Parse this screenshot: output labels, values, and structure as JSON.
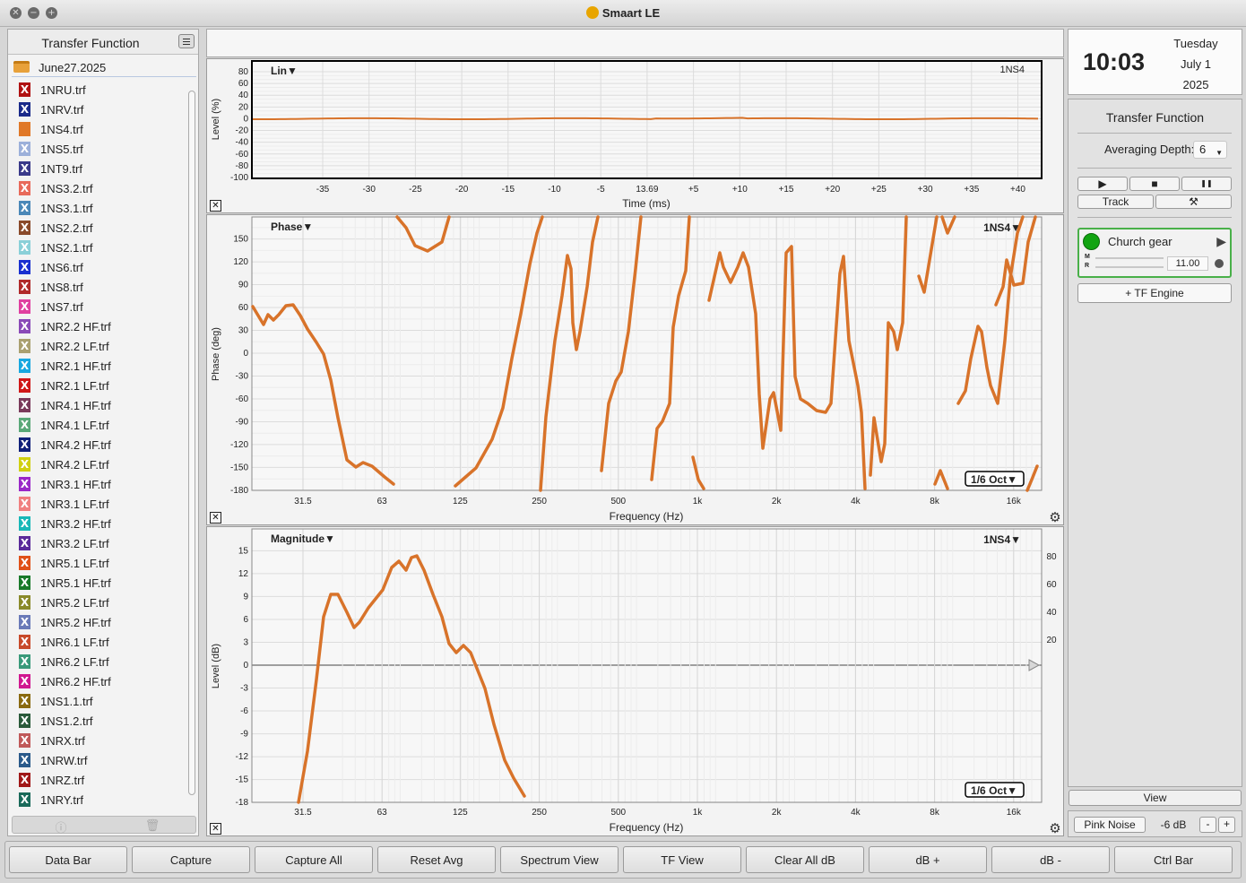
{
  "window": {
    "title": "Smaart LE"
  },
  "left_panel": {
    "title": "Transfer Function",
    "folder": "June27.2025",
    "files": [
      {
        "name": "1NRU.trf",
        "color": "#b01212",
        "glyph": "X"
      },
      {
        "name": "1NRV.trf",
        "color": "#1a2a8a",
        "glyph": "X"
      },
      {
        "name": "1NS4.trf",
        "color": "#e07828",
        "glyph": ""
      },
      {
        "name": "1NS5.trf",
        "color": "#9cb0da",
        "glyph": "X"
      },
      {
        "name": "1NT9.trf",
        "color": "#3a3a8a",
        "glyph": "X"
      },
      {
        "name": "1NS3.2.trf",
        "color": "#e86a5a",
        "glyph": "X"
      },
      {
        "name": "1NS3.1.trf",
        "color": "#4a88b8",
        "glyph": "X"
      },
      {
        "name": "1NS2.2.trf",
        "color": "#8a4a2a",
        "glyph": "X"
      },
      {
        "name": "1NS2.1.trf",
        "color": "#8ad0d8",
        "glyph": "X"
      },
      {
        "name": "1NS6.trf",
        "color": "#1a30d0",
        "glyph": "X"
      },
      {
        "name": "1NS8.trf",
        "color": "#b02a2a",
        "glyph": "X"
      },
      {
        "name": "1NS7.trf",
        "color": "#e040a0",
        "glyph": "X"
      },
      {
        "name": "1NR2.2 HF.trf",
        "color": "#8a4ab8",
        "glyph": "X"
      },
      {
        "name": "1NR2.2 LF.trf",
        "color": "#aaa070",
        "glyph": "X"
      },
      {
        "name": "1NR2.1 HF.trf",
        "color": "#18a8e0",
        "glyph": "X"
      },
      {
        "name": "1NR2.1 LF.trf",
        "color": "#d01818",
        "glyph": "X"
      },
      {
        "name": "1NR4.1 HF.trf",
        "color": "#7a3a5a",
        "glyph": "X"
      },
      {
        "name": "1NR4.1 LF.trf",
        "color": "#5aa878",
        "glyph": "X"
      },
      {
        "name": "1NR4.2 HF.trf",
        "color": "#10207a",
        "glyph": "X"
      },
      {
        "name": "1NR4.2 LF.trf",
        "color": "#d0d010",
        "glyph": "X"
      },
      {
        "name": "1NR3.1 HF.trf",
        "color": "#9a28c8",
        "glyph": "X"
      },
      {
        "name": "1NR3.1 LF.trf",
        "color": "#f08080",
        "glyph": "X"
      },
      {
        "name": "1NR3.2 HF.trf",
        "color": "#18b8b8",
        "glyph": "X"
      },
      {
        "name": "1NR3.2 LF.trf",
        "color": "#5a2a9a",
        "glyph": "X"
      },
      {
        "name": "1NR5.1 LF.trf",
        "color": "#e05018",
        "glyph": "X"
      },
      {
        "name": "1NR5.1 HF.trf",
        "color": "#1a7a2a",
        "glyph": "X"
      },
      {
        "name": "1NR5.2 LF.trf",
        "color": "#8a8a2a",
        "glyph": "X"
      },
      {
        "name": "1NR5.2 HF.trf",
        "color": "#6a7ab8",
        "glyph": "X"
      },
      {
        "name": "1NR6.1 LF.trf",
        "color": "#c84a2a",
        "glyph": "X"
      },
      {
        "name": "1NR6.2 LF.trf",
        "color": "#3a9a7a",
        "glyph": "X"
      },
      {
        "name": "1NR6.2 HF.trf",
        "color": "#d01890",
        "glyph": "X"
      },
      {
        "name": "1NS1.1.trf",
        "color": "#8a6a10",
        "glyph": "X"
      },
      {
        "name": "1NS1.2.trf",
        "color": "#2a5a3a",
        "glyph": "X"
      },
      {
        "name": "1NRX.trf",
        "color": "#c05a5a",
        "glyph": "X"
      },
      {
        "name": "1NRW.trf",
        "color": "#2a5a8a",
        "glyph": "X"
      },
      {
        "name": "1NRZ.trf",
        "color": "#a01818",
        "glyph": "X"
      },
      {
        "name": "1NRY.trf",
        "color": "#1a6a5a",
        "glyph": "X"
      }
    ]
  },
  "plots": {
    "trace_color": "#d8732a",
    "impulse": {
      "title": "Lin▼",
      "trace": "1NS4",
      "ylabel": "Level (%)",
      "xlabel": "Time (ms)",
      "yticks": [
        "80",
        "60",
        "40",
        "20",
        "0",
        "-20",
        "-40",
        "-60",
        "-80",
        "-100"
      ],
      "xticks": [
        "-35",
        "-30",
        "-25",
        "-20",
        "-15",
        "-10",
        "-5",
        "13.69",
        "+5",
        "+10",
        "+15",
        "+20",
        "+25",
        "+30",
        "+35",
        "+40"
      ]
    },
    "phase": {
      "title": "Phase▼",
      "trace": "1NS4▼",
      "ylabel": "Phase (deg)",
      "xlabel": "Frequency (Hz)",
      "smoothing": "1/6 Oct▼",
      "yticks": [
        "150",
        "120",
        "90",
        "60",
        "30",
        "0",
        "-30",
        "-60",
        "-90",
        "-120",
        "-150",
        "-180"
      ],
      "xticks": [
        "31.5",
        "63",
        "125",
        "250",
        "500",
        "1k",
        "2k",
        "4k",
        "8k",
        "16k"
      ]
    },
    "magnitude": {
      "title": "Magnitude▼",
      "trace": "1NS4▼",
      "ylabel": "Level (dB)",
      "xlabel": "Frequency (Hz)",
      "smoothing": "1/6 Oct▼",
      "yticks": [
        "15",
        "12",
        "9",
        "6",
        "3",
        "0",
        "-3",
        "-6",
        "-9",
        "-12",
        "-15",
        "-18"
      ],
      "yticks_right": [
        "80",
        "60",
        "40",
        "20"
      ],
      "xticks": [
        "31.5",
        "63",
        "125",
        "250",
        "500",
        "1k",
        "2k",
        "4k",
        "8k",
        "16k"
      ]
    }
  },
  "clock": {
    "time": "10:03",
    "day": "Tuesday",
    "date": "July 1",
    "year": "2025"
  },
  "controls": {
    "title": "Transfer Function",
    "averaging_label": "Averaging Depth:",
    "averaging_value": "6",
    "play_icon": "▶",
    "stop_icon": "■",
    "pause_icon": "❚❚",
    "track_label": "Track",
    "tools_icon": "⚒",
    "engine_name": "Church gear",
    "engine_m": "M",
    "engine_r": "R",
    "engine_value": "11.00",
    "add_engine": "+ TF Engine",
    "view_label": "View",
    "pink_noise": "Pink Noise",
    "pink_level": "-6 dB",
    "minus": "-",
    "plus": "+"
  },
  "bottom_bar": [
    "Data Bar",
    "Capture",
    "Capture All",
    "Reset Avg",
    "Spectrum View",
    "TF View",
    "Clear All dB",
    "dB +",
    "dB -",
    "Ctrl Bar"
  ]
}
